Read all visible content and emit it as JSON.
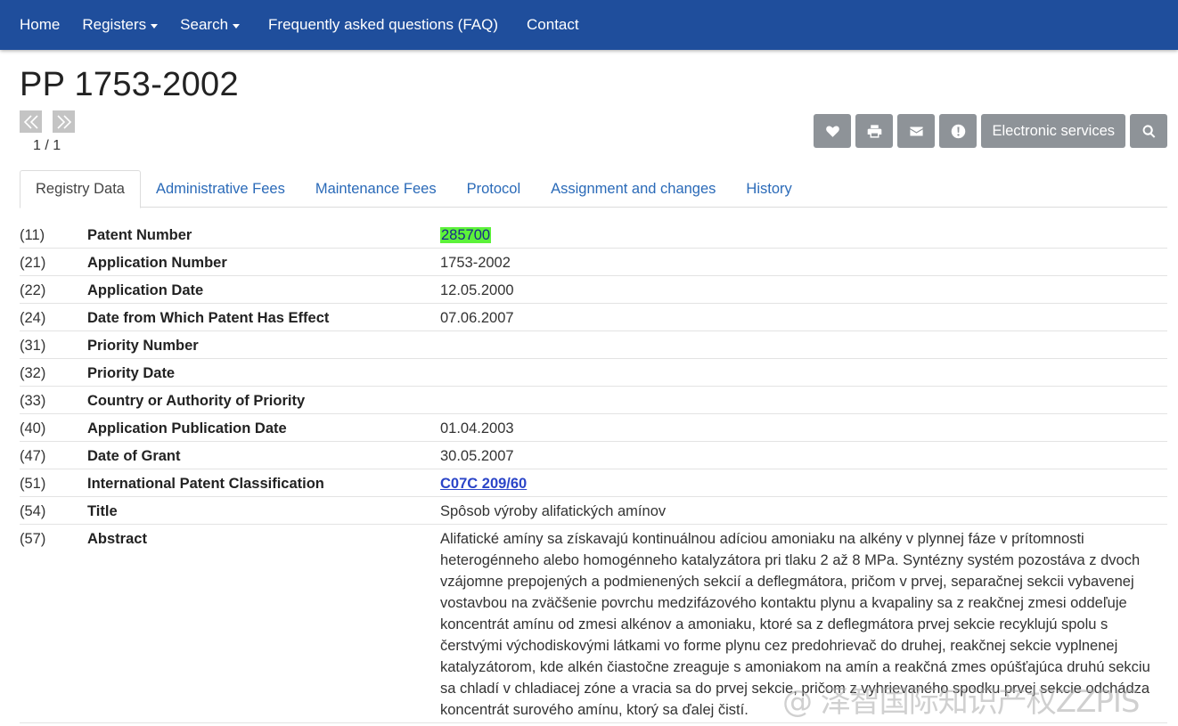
{
  "nav": {
    "home": "Home",
    "registers": "Registers",
    "search": "Search",
    "faq": "Frequently asked questions (FAQ)",
    "contact": "Contact"
  },
  "page_title": "PP 1753-2002",
  "pager": {
    "count": "1 / 1"
  },
  "actions": {
    "electronic_services": "Electronic services"
  },
  "tabs": [
    {
      "label": "Registry Data"
    },
    {
      "label": "Administrative Fees"
    },
    {
      "label": "Maintenance Fees"
    },
    {
      "label": "Protocol"
    },
    {
      "label": "Assignment and changes"
    },
    {
      "label": "History"
    }
  ],
  "rows": [
    {
      "code": "(11)",
      "label": "Patent Number",
      "value": "285700"
    },
    {
      "code": "(21)",
      "label": "Application Number",
      "value": "1753-2002"
    },
    {
      "code": "(22)",
      "label": "Application Date",
      "value": "12.05.2000"
    },
    {
      "code": "(24)",
      "label": "Date from Which Patent Has Effect",
      "value": "07.06.2007"
    },
    {
      "code": "(31)",
      "label": "Priority Number",
      "value": ""
    },
    {
      "code": "(32)",
      "label": "Priority Date",
      "value": ""
    },
    {
      "code": "(33)",
      "label": "Country or Authority of Priority",
      "value": ""
    },
    {
      "code": "(40)",
      "label": "Application Publication Date",
      "value": "01.04.2003"
    },
    {
      "code": "(47)",
      "label": "Date of Grant",
      "value": "30.05.2007"
    },
    {
      "code": "(51)",
      "label": "International Patent Classification",
      "value": "C07C 209/60"
    },
    {
      "code": "(54)",
      "label": "Title",
      "value": "Spôsob výroby alifatických amínov"
    },
    {
      "code": "(57)",
      "label": "Abstract",
      "value": "Alifatické amíny sa získavajú kontinuálnou adíciou amoniaku na alkény v plynnej fáze v prítomnosti heterogénneho alebo homogénneho katalyzátora pri tlaku 2 až 8 MPa. Syntézny systém pozostáva z dvoch vzájomne prepojených a podmienených sekcií a deflegmátora, pričom v prvej, separačnej sekcii vybavenej vostavbou na zväčšenie povrchu medzifázového kontaktu plynu a kvapaliny sa z reakčnej zmesi oddeľuje koncentrát amínu od zmesi alkénov a amoniaku, ktoré sa z deflegmátora prvej sekcie recyklujú spolu s čerstvými východiskovými látkami vo forme plynu cez predohrievač do druhej, reakčnej sekcie vyplnenej katalyzátorom, kde alkén čiastočne zreaguje s amoniakom na amín a reakčná zmes opúšťajúca druhú sekciu sa chladí v chladiacej zóne a vracia sa do prvej sekcie, pričom z vyhrievaného spodku prvej sekcie odchádza koncentrát surového amínu, ktorý sa ďalej čistí."
    }
  ],
  "watermark": "@ 泽智国际知识产权ZZPIS"
}
